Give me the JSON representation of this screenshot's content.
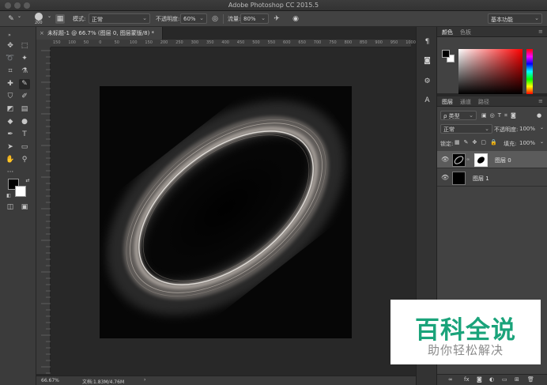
{
  "window": {
    "title": "Adobe Photoshop CC 2015.5"
  },
  "options_bar": {
    "brush_size": "200",
    "mode_label": "模式:",
    "mode_value": "正常",
    "opacity_label": "不透明度:",
    "opacity_value": "60%",
    "flow_label": "流量:",
    "flow_value": "80%",
    "workspace": "基本功能"
  },
  "document": {
    "tab_label": "未标题-1 @ 66.7% (图层 0, 图层蒙版/8) *",
    "ruler_ticks": [
      "150",
      "100",
      "50",
      "0",
      "50",
      "100",
      "150",
      "200",
      "250",
      "300",
      "350",
      "400",
      "450",
      "500",
      "550",
      "600",
      "650",
      "700",
      "750",
      "800",
      "850",
      "900",
      "950",
      "1000"
    ],
    "zoom": "66.67%",
    "doc_info": "文档:1.83M/4.76M"
  },
  "color_panel": {
    "tabs": [
      "颜色",
      "色板"
    ]
  },
  "layers_panel": {
    "tabs": [
      "图层",
      "通道",
      "路径"
    ],
    "filter_kind": "ρ 类型",
    "blend_mode": "正常",
    "opacity_label": "不透明度:",
    "opacity_value": "100%",
    "lock_label": "锁定:",
    "fill_label": "填充:",
    "fill_value": "100%",
    "layers": [
      {
        "name": "图层 0"
      },
      {
        "name": "图层 1"
      }
    ]
  },
  "watermark": {
    "main": "百科全说",
    "sub": "助你轻松解决"
  },
  "colors": {
    "accent_green": "#1aa37a",
    "panel_bg": "#424242",
    "canvas_bg": "#060606"
  }
}
